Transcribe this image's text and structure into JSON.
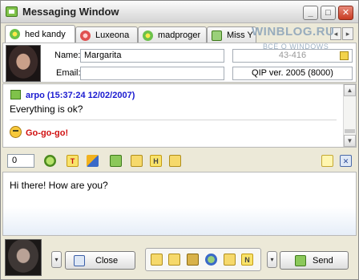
{
  "window": {
    "title": "Messaging Window",
    "controls": {
      "minimize": "_",
      "maximize": "□",
      "close": "✕"
    }
  },
  "tabs": [
    {
      "label": "hed kandy",
      "icon": "flower-icon",
      "active": true
    },
    {
      "label": "Luxeona",
      "icon": "flower-icon",
      "active": false
    },
    {
      "label": "madproger",
      "icon": "flower-icon",
      "active": false
    },
    {
      "label": "Miss Y",
      "icon": "status-icon",
      "active": false
    }
  ],
  "watermark": {
    "site": "WINBLOG.RU",
    "tagline": "ВСЁ О WINDOWS"
  },
  "contact": {
    "name_label": "Name:",
    "name_value": "Margarita",
    "email_label": "Email:",
    "email_value": "",
    "uin": "43-416",
    "client": "QIP ver. 2005 (8000)"
  },
  "history": {
    "messages": [
      {
        "header": "arpo (15:37:24 12/02/2007)",
        "text": "Everything is ok?"
      },
      {
        "header": "",
        "text": "Go-go-go!"
      }
    ],
    "scroll_up": "▲",
    "scroll_down": "▼"
  },
  "toolbar": {
    "counter": "0",
    "icons": [
      "smiley-icon",
      "text-format-icon",
      "font-color-icon",
      "save-icon",
      "folder-icon",
      "history-icon",
      "notes-icon",
      "close-tab-icon"
    ]
  },
  "input": {
    "text": "Hi there! How are you?"
  },
  "bottom": {
    "close_label": "Close",
    "send_label": "Send",
    "drop_arrow": "▾",
    "mini_icons": [
      "quote-icon",
      "info-icon",
      "contact-icon",
      "network-icon",
      "layout-icon",
      "notify-icon"
    ],
    "letters": {
      "t": "T",
      "h": "H",
      "n": "N"
    }
  },
  "colors": {
    "accent_blue": "#1a1ad0",
    "accent_red": "#d01010",
    "frame": "#ece9d8"
  }
}
